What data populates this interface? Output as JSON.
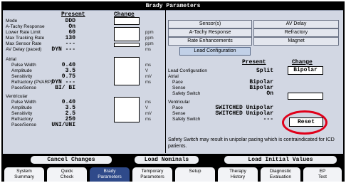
{
  "window": {
    "title": "Brady Parameters"
  },
  "left": {
    "col_present": "Present",
    "col_change": "Change",
    "rows": [
      {
        "label": "Mode",
        "value": "DDD",
        "unit": ""
      },
      {
        "label": "A-Tachy Response",
        "value": "On",
        "unit": ""
      },
      {
        "label": "Lower Rate Limit",
        "value": "60",
        "unit": "ppm"
      },
      {
        "label": "Max Tracking Rate",
        "value": "130",
        "unit": "ppm"
      },
      {
        "label": "Max Sensor Rate",
        "value": "---",
        "unit": "ppm"
      },
      {
        "label": "AV Delay (paced)",
        "value": "DYN  ---",
        "unit": "ms"
      },
      {
        "label": "Atrial",
        "value": "",
        "unit": ""
      },
      {
        "label": "Pulse Width",
        "value": "0.40",
        "unit": "ms"
      },
      {
        "label": "Amplitude",
        "value": "3.5",
        "unit": "V"
      },
      {
        "label": "Sensitivity",
        "value": "0.75",
        "unit": "mV"
      },
      {
        "label": "Refractory (PVARP)",
        "value": "DYN  ---",
        "unit": "ms"
      },
      {
        "label": "Pace/Sense",
        "value": "BI/ BI",
        "unit": ""
      },
      {
        "label": "Ventricular",
        "value": "",
        "unit": ""
      },
      {
        "label": "Pulse Width",
        "value": "0.40",
        "unit": "ms"
      },
      {
        "label": "Amplitude",
        "value": "3.5",
        "unit": "V"
      },
      {
        "label": "Sensitivity",
        "value": "2.5",
        "unit": "mV"
      },
      {
        "label": "Refractory",
        "value": "250",
        "unit": "ms"
      },
      {
        "label": "Pace/Sense",
        "value": "UNI/UNI",
        "unit": ""
      }
    ]
  },
  "tabs": [
    {
      "label": "Sensor(s)",
      "active": false
    },
    {
      "label": "AV Delay",
      "active": false
    },
    {
      "label": "A-Tachy Response",
      "active": false
    },
    {
      "label": "Refractory",
      "active": false
    },
    {
      "label": "Rate Enhancements",
      "active": false
    },
    {
      "label": "Magnet",
      "active": false
    },
    {
      "label": "Lead Configuration",
      "active": true
    }
  ],
  "right": {
    "col_present": "Present",
    "col_change": "Change",
    "lead_config_label": "Lead Configuration",
    "lead_config_value": "Split",
    "lead_config_change": "Bipolar",
    "atrial_label": "Atrial",
    "a_pace_label": "Pace",
    "a_pace_value": "Bipolar",
    "a_sense_label": "Sense",
    "a_sense_value": "Bipolar",
    "a_safety_label": "Safety Switch",
    "a_safety_value": "On",
    "ventricular_label": "Ventricular",
    "v_pace_label": "Pace",
    "v_pace_value": "SWITCHED Unipolar",
    "v_sense_label": "Sense",
    "v_sense_value": "SWITCHED Unipolar",
    "v_safety_label": "Safety Switch",
    "v_safety_value": "---",
    "reset_label": "Reset",
    "warning": "Safety Switch may result in unipolar pacing which is contraindicated for ICD patients."
  },
  "actions": {
    "cancel": "Cancel Changes",
    "load_nominals": "Load Nominals",
    "load_initial": "Load Initial Values"
  },
  "nav": [
    {
      "line1": "System",
      "line2": "Summary",
      "active": false
    },
    {
      "line1": "Quick",
      "line2": "Check",
      "active": false
    },
    {
      "line1": "Brady",
      "line2": "Parameters",
      "active": true
    },
    {
      "line1": "Temporary",
      "line2": "Parameters",
      "active": false
    },
    {
      "line1": "Setup",
      "line2": "",
      "active": false
    },
    {
      "line1": "Therapy",
      "line2": "History",
      "active": false
    },
    {
      "line1": "Diagnostic",
      "line2": "Evaluation",
      "active": false
    },
    {
      "line1": "EP",
      "line2": "Test",
      "active": false
    }
  ],
  "colors": {
    "panel": "#d2d7e3",
    "active_nav": "#2f4a8a",
    "active_tab": "#c1d0e7",
    "highlight": "#e0001a"
  }
}
